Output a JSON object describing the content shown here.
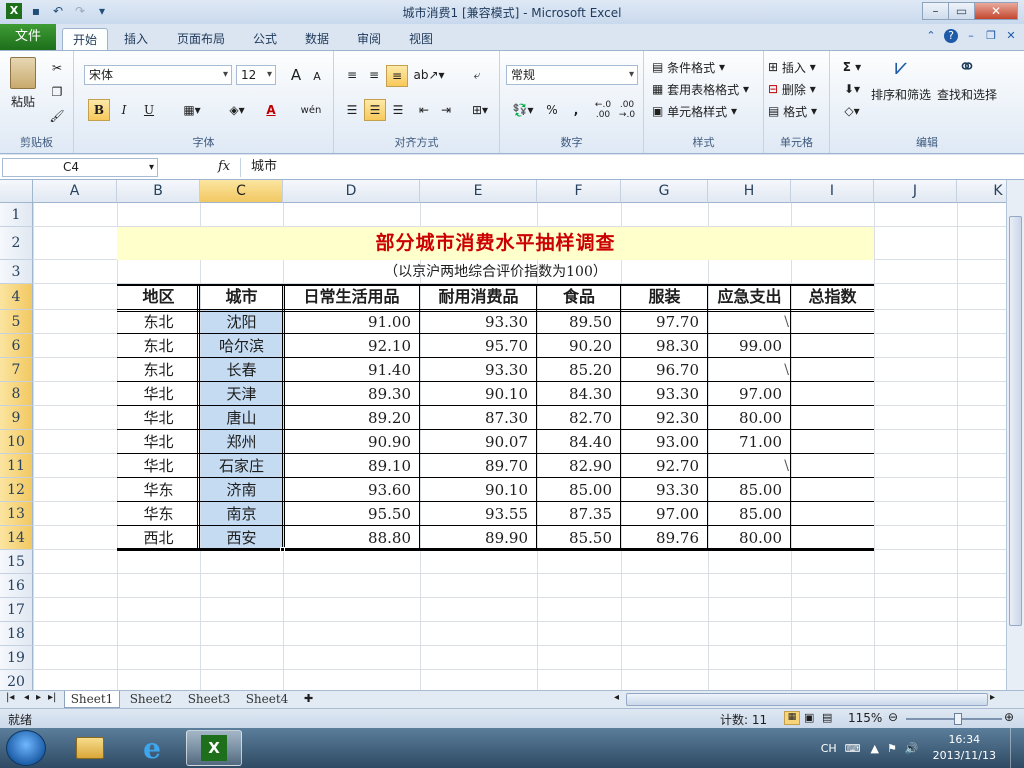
{
  "window": {
    "title": "城市消费1  [兼容模式] - Microsoft Excel",
    "controls": [
      "–",
      "▭",
      "✕"
    ]
  },
  "tabs": {
    "file": "文件",
    "items": [
      "开始",
      "插入",
      "页面布局",
      "公式",
      "数据",
      "审阅",
      "视图"
    ],
    "active": "开始"
  },
  "ribbon": {
    "clipboard": {
      "paste": "粘贴",
      "label": "剪贴板"
    },
    "font": {
      "name": "宋体",
      "size": "12",
      "bold": "B",
      "italic": "I",
      "underline": "U",
      "grow": "A",
      "shrink": "A",
      "color_a": "A",
      "wen": "wén",
      "label": "字体"
    },
    "alignment": {
      "label": "对齐方式"
    },
    "number": {
      "format": "常规",
      "percent": "%",
      "comma": ",",
      "inc": "←.0 .00",
      "dec": ".00 →.0",
      "label": "数字"
    },
    "styles": {
      "conditional": "条件格式",
      "table": "套用表格格式",
      "cell": "单元格样式",
      "label": "样式"
    },
    "cells": {
      "insert": "插入",
      "delete": "删除",
      "format": "格式",
      "label": "单元格"
    },
    "editing": {
      "sigma": "Σ",
      "sort": "排序和筛选",
      "find": "查找和选择",
      "label": "编辑"
    }
  },
  "formula_bar": {
    "name_box": "C4",
    "fx": "fx",
    "value": "城市"
  },
  "sheet": {
    "columns": [
      "A",
      "B",
      "C",
      "D",
      "E",
      "F",
      "G",
      "H",
      "I",
      "J",
      "K"
    ],
    "selected_column": "C",
    "rows": [
      "1",
      "2",
      "3",
      "4",
      "5",
      "6",
      "7",
      "8",
      "9",
      "10",
      "11",
      "12",
      "13",
      "14",
      "15",
      "16",
      "17",
      "18",
      "19",
      "20"
    ],
    "title": "部分城市消费水平抽样调查",
    "subtitle": "（以京沪两地综合评价指数为100）",
    "headers": [
      "地区",
      "城市",
      "日常生活用品",
      "耐用消费品",
      "食品",
      "服装",
      "应急支出",
      "总指数"
    ],
    "records": [
      [
        "东北",
        "沈阳",
        "91.00",
        "93.30",
        "89.50",
        "97.70",
        "\\",
        ""
      ],
      [
        "东北",
        "哈尔滨",
        "92.10",
        "95.70",
        "90.20",
        "98.30",
        "99.00",
        ""
      ],
      [
        "东北",
        "长春",
        "91.40",
        "93.30",
        "85.20",
        "96.70",
        "\\",
        ""
      ],
      [
        "华北",
        "天津",
        "89.30",
        "90.10",
        "84.30",
        "93.30",
        "97.00",
        ""
      ],
      [
        "华北",
        "唐山",
        "89.20",
        "87.30",
        "82.70",
        "92.30",
        "80.00",
        ""
      ],
      [
        "华北",
        "郑州",
        "90.90",
        "90.07",
        "84.40",
        "93.00",
        "71.00",
        ""
      ],
      [
        "华北",
        "石家庄",
        "89.10",
        "89.70",
        "82.90",
        "92.70",
        "\\",
        ""
      ],
      [
        "华东",
        "济南",
        "93.60",
        "90.10",
        "85.00",
        "93.30",
        "85.00",
        ""
      ],
      [
        "华东",
        "南京",
        "95.50",
        "93.55",
        "87.35",
        "97.00",
        "85.00",
        ""
      ],
      [
        "西北",
        "西安",
        "88.80",
        "89.90",
        "85.50",
        "89.76",
        "80.00",
        ""
      ]
    ]
  },
  "sheet_tabs": [
    "Sheet1",
    "Sheet2",
    "Sheet3",
    "Sheet4"
  ],
  "active_sheet": "Sheet1",
  "status": {
    "mode": "就绪",
    "count": "计数: 11",
    "zoom": "115%"
  },
  "taskbar": {
    "lang": "CH",
    "time": "16:34",
    "date": "2013/11/13"
  },
  "colors": {
    "title_red": "#cc0000",
    "title_fill": "#ffffcc",
    "selected_fill": "#c5dbf2",
    "excel_green": "#1d6f1b"
  }
}
